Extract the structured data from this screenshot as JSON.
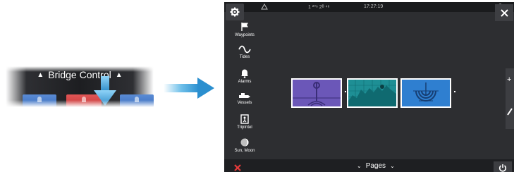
{
  "bridge_control": {
    "label": "Bridge Control",
    "chevron_left": "^",
    "chevron_right": "^"
  },
  "statusbar": {
    "gps": "1 ²⁰⁶ 2ᴮ ⁴⁸",
    "time": "17:27:19"
  },
  "sidebar": {
    "items": [
      {
        "label": "Waypoints",
        "icon": "flag-icon"
      },
      {
        "label": "Tides",
        "icon": "wave-icon"
      },
      {
        "label": "Alarms",
        "icon": "bell-icon"
      },
      {
        "label": "Vessels",
        "icon": "vessel-icon"
      },
      {
        "label": "TripIntel",
        "icon": "tripintel-icon"
      },
      {
        "label": "Sun, Moon",
        "icon": "moon-icon"
      }
    ]
  },
  "bottom": {
    "pages_label": "Pages",
    "chevron": "⌄"
  },
  "colors": {
    "screen_bg": "#2d2e31",
    "accent_blue": "#3a9bd6",
    "thumb_purple": "#6b57b8",
    "thumb_teal": "#1e8f95",
    "thumb_blue": "#2f7fd0",
    "alert_red": "#e23a3a"
  }
}
